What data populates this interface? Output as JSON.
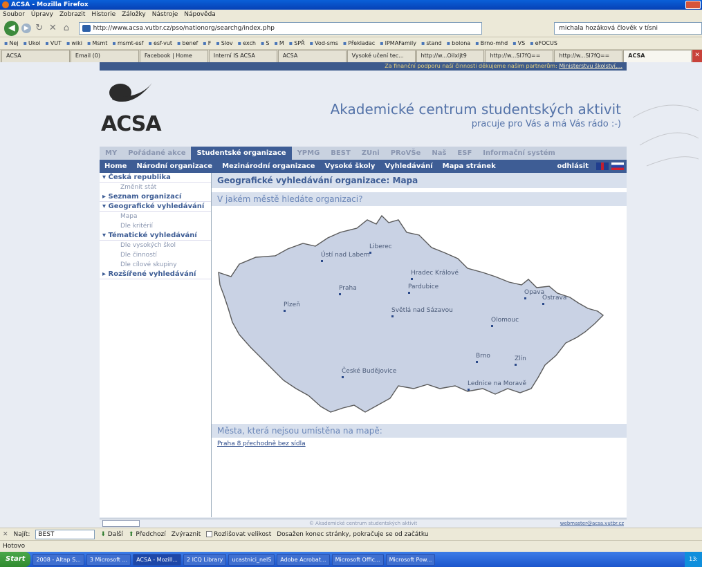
{
  "window": {
    "title": "ACSA - Mozilla Firefox"
  },
  "menu": [
    "Soubor",
    "Úpravy",
    "Zobrazit",
    "Historie",
    "Záložky",
    "Nástroje",
    "Nápověda"
  ],
  "nav": {
    "url": "http://www.acsa.vutbr.cz/pso/nationorg/searchg/index.php",
    "search_value": "michala hozáková člověk v tísni"
  },
  "bookmarks": [
    "Nej",
    "Ukol",
    "VUT",
    "wiki",
    "Msmt",
    "msmt-esf",
    "esf-vut",
    "benef",
    "F",
    "Slov",
    "exch",
    "S",
    "M",
    "SPŘ",
    "Vod-sms",
    "Překladac",
    "IPMAFamily",
    "stand",
    "bolona",
    "Brno-mhd",
    "VS",
    "eFOCUS"
  ],
  "tabs": [
    "ACSA",
    "Email (0)",
    "Facebook | Home",
    "Interní IS ACSA",
    "ACSA",
    "Vysoké učení tec...",
    "http://w...OiIxIjt9",
    "http://w...SI7fQ==",
    "http://w...SI7fQ==",
    "ACSA"
  ],
  "site": {
    "promo_text": "Za finanční podporu naší činnosti děkujeme našim partnerům:",
    "promo_link": "Ministerstvu školství,...",
    "logo_text": "ACSA",
    "heading": "Akademické centrum studentských aktivit",
    "subheading": "pracuje pro Vás a má Vás rádo :-)",
    "topnav": [
      "MY",
      "Pořádané akce",
      "Studentské organizace",
      "YPMG",
      "BEST",
      "ZUni",
      "PRoVŠe",
      "Naš",
      "ESF",
      "Informační systém"
    ],
    "subnav": [
      "Home",
      "Národní organizace",
      "Mezinárodní organizace",
      "Vysoké školy",
      "Vyhledávání",
      "Mapa stránek"
    ],
    "logout": "odhlásit"
  },
  "sidebar": [
    {
      "label": "▾ Česká republika",
      "type": "sec"
    },
    {
      "label": "Změnit stát",
      "type": "sub"
    },
    {
      "label": "▸ Seznam organizací",
      "type": "sec"
    },
    {
      "label": "▾ Geografické vyhledávání",
      "type": "sec"
    },
    {
      "label": "Mapa",
      "type": "sub"
    },
    {
      "label": "Dle kritérií",
      "type": "sub"
    },
    {
      "label": "▾ Tématické vyhledávání",
      "type": "sec"
    },
    {
      "label": "Dle vysokých škol",
      "type": "sub"
    },
    {
      "label": "Dle činností",
      "type": "sub"
    },
    {
      "label": "Dle cílové skupiny",
      "type": "sub"
    },
    {
      "label": "▸ Rozšířené vyhledávání",
      "type": "sec"
    }
  ],
  "content": {
    "title": "Geografické vyhledávání organizace: Mapa",
    "question": "V jakém městě hledáte organizaci?",
    "cities_heading": "Města, která nejsou umístěna na mapě:",
    "city_link": "Praha 8 přechodně bez sídla"
  },
  "cities": [
    "Liberec",
    "Ústí nad Labem",
    "Hradec Králové",
    "Pardubice",
    "Praha",
    "Opava",
    "Ostrava",
    "Plzeň",
    "Světlá nad Sázavou",
    "Olomouc",
    "Brno",
    "Zlín",
    "České Budějovice",
    "Lednice na Moravě"
  ],
  "footer": {
    "copyright": "© Akademické centrum studentských aktivit",
    "email": "webmaster@acsa.vutbr.cz"
  },
  "find": {
    "label": "Najít:",
    "value": "BEST",
    "next": "Další",
    "prev": "Předchozí",
    "highlight": "Zvýraznit",
    "case": "Rozlišovat velikost",
    "message": "Dosažen konec stránky, pokračuje se od začátku"
  },
  "status": "Hotovo",
  "taskbar": {
    "start": "Start",
    "items": [
      "2008 - Altap S...",
      "3 Microsoft ...",
      "ACSA - Mozill...",
      "2 ICQ Library",
      "ucastnici_nelS",
      "Adobe Acrobat...",
      "Microsoft Offic...",
      "Microsoft Pow..."
    ],
    "clock": "13:"
  }
}
